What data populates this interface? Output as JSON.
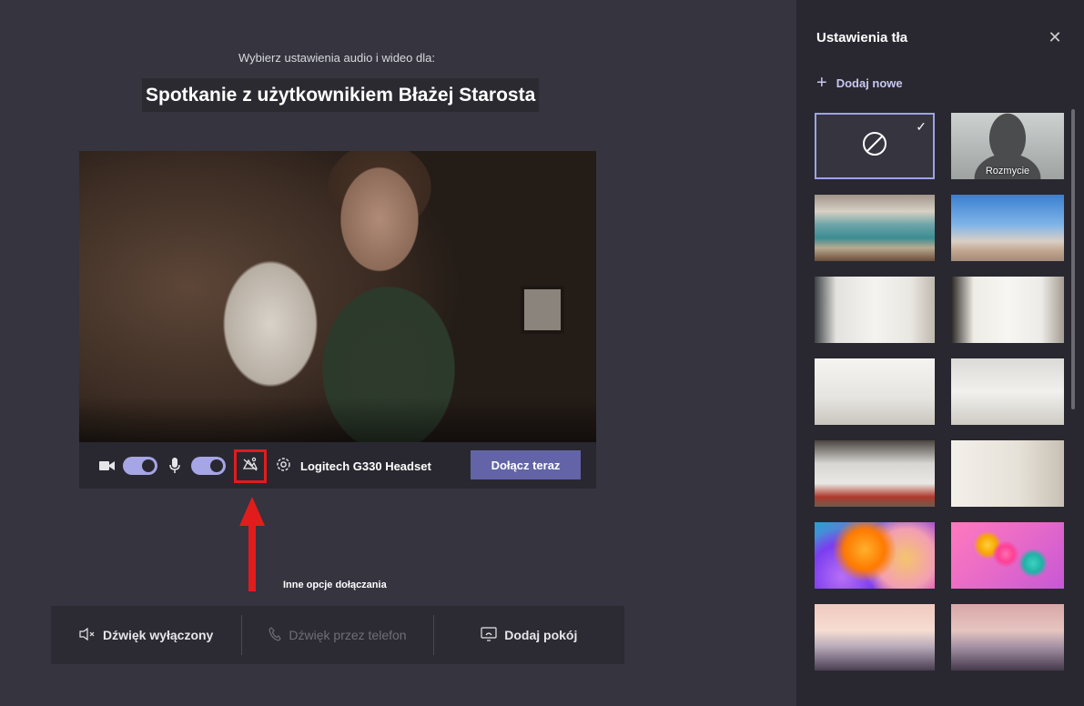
{
  "prejoin": {
    "subtitle": "Wybierz ustawienia audio i wideo dla:",
    "meeting_title": "Spotkanie z użytkownikiem Błażej Starosta"
  },
  "controls": {
    "device_label": "Logitech G330 Headset",
    "join_label": "Dołącz teraz"
  },
  "annotation": {
    "label": "Inne opcje dołączania"
  },
  "audio_options": [
    {
      "label": "Dźwięk wyłączony",
      "icon": "speaker-off-icon",
      "enabled": true
    },
    {
      "label": "Dźwięk przez telefon",
      "icon": "phone-icon",
      "enabled": false
    },
    {
      "label": "Dodaj pokój",
      "icon": "room-cast-icon",
      "enabled": true
    }
  ],
  "panel": {
    "title": "Ustawienia tła",
    "add_new": "Dodaj nowe",
    "thumbnails": [
      {
        "label": ""
      },
      {
        "label": "Rozmycie"
      }
    ]
  },
  "colors": {
    "accent": "#6264a7",
    "toggle_on": "#a6a5e6",
    "highlight_box": "#e21c1c"
  }
}
